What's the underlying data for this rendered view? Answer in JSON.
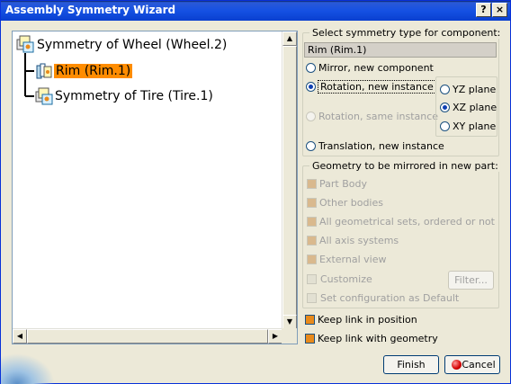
{
  "window": {
    "title": "Assembly Symmetry Wizard",
    "help_label": "?",
    "close_label": "×"
  },
  "tree": {
    "root": "Symmetry of Wheel (Wheel.2)",
    "children": [
      "Rim (Rim.1)",
      "Symmetry of Tire (Tire.1)"
    ],
    "selected_index": 0
  },
  "symmetry_type": {
    "label": "Select symmetry type for component:",
    "component": "Rim (Rim.1)",
    "options": [
      "Mirror, new component",
      "Rotation, new instance",
      "Rotation, same instance",
      "Translation, new instance"
    ],
    "selected": "Rotation, new instance",
    "planes": [
      "YZ plane",
      "XZ plane",
      "XY plane"
    ],
    "selected_plane": "XZ plane"
  },
  "geometry": {
    "label": "Geometry to be mirrored in new part:",
    "items": [
      "Part Body",
      "Other bodies",
      "All geometrical sets, ordered or not",
      "All axis systems",
      "External view",
      "Customize",
      "Set configuration as Default"
    ],
    "filter_label": "Filter..."
  },
  "links": {
    "keep_position": "Keep link in position",
    "keep_geometry": "Keep link with geometry"
  },
  "buttons": {
    "finish": "Finish",
    "cancel": "Cancel"
  },
  "colors": {
    "titlebar": "#1551e3",
    "selection": "#ff8c00",
    "checkbox_on": "#e88a1c"
  }
}
